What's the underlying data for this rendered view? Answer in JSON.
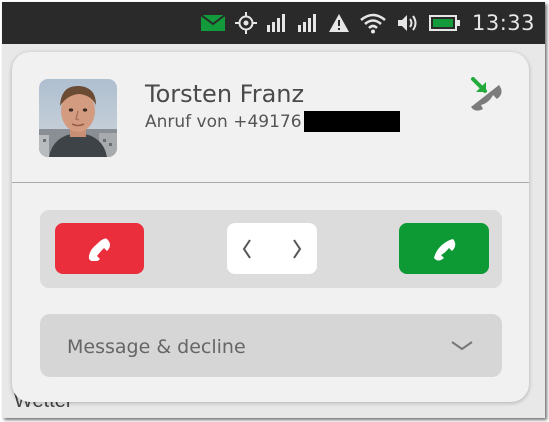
{
  "status_bar": {
    "time": "13:33",
    "icons": [
      "message-icon",
      "gps-icon",
      "signal-icon",
      "signal-icon",
      "alert-icon",
      "wifi-icon",
      "volume-icon",
      "battery-icon"
    ]
  },
  "background": {
    "partial_text": "Wetter"
  },
  "dialog": {
    "avatar": "avatar-photo",
    "caller_name": "Torsten Franz",
    "caller_number": "Anruf von +49176",
    "call_status_icon": "incoming-call-icon",
    "colors": {
      "decline": "#ea2e3c",
      "accept": "#0d9a34",
      "incoming_arrow": "#22aa3a"
    }
  },
  "actions": {
    "decline": "phone-hangup-icon",
    "ignore": [
      "chevron-left-icon",
      "chevron-right-icon"
    ],
    "accept": "phone-icon"
  },
  "message_decline": {
    "label": "Message & decline",
    "icon": "chevron-down-icon"
  }
}
